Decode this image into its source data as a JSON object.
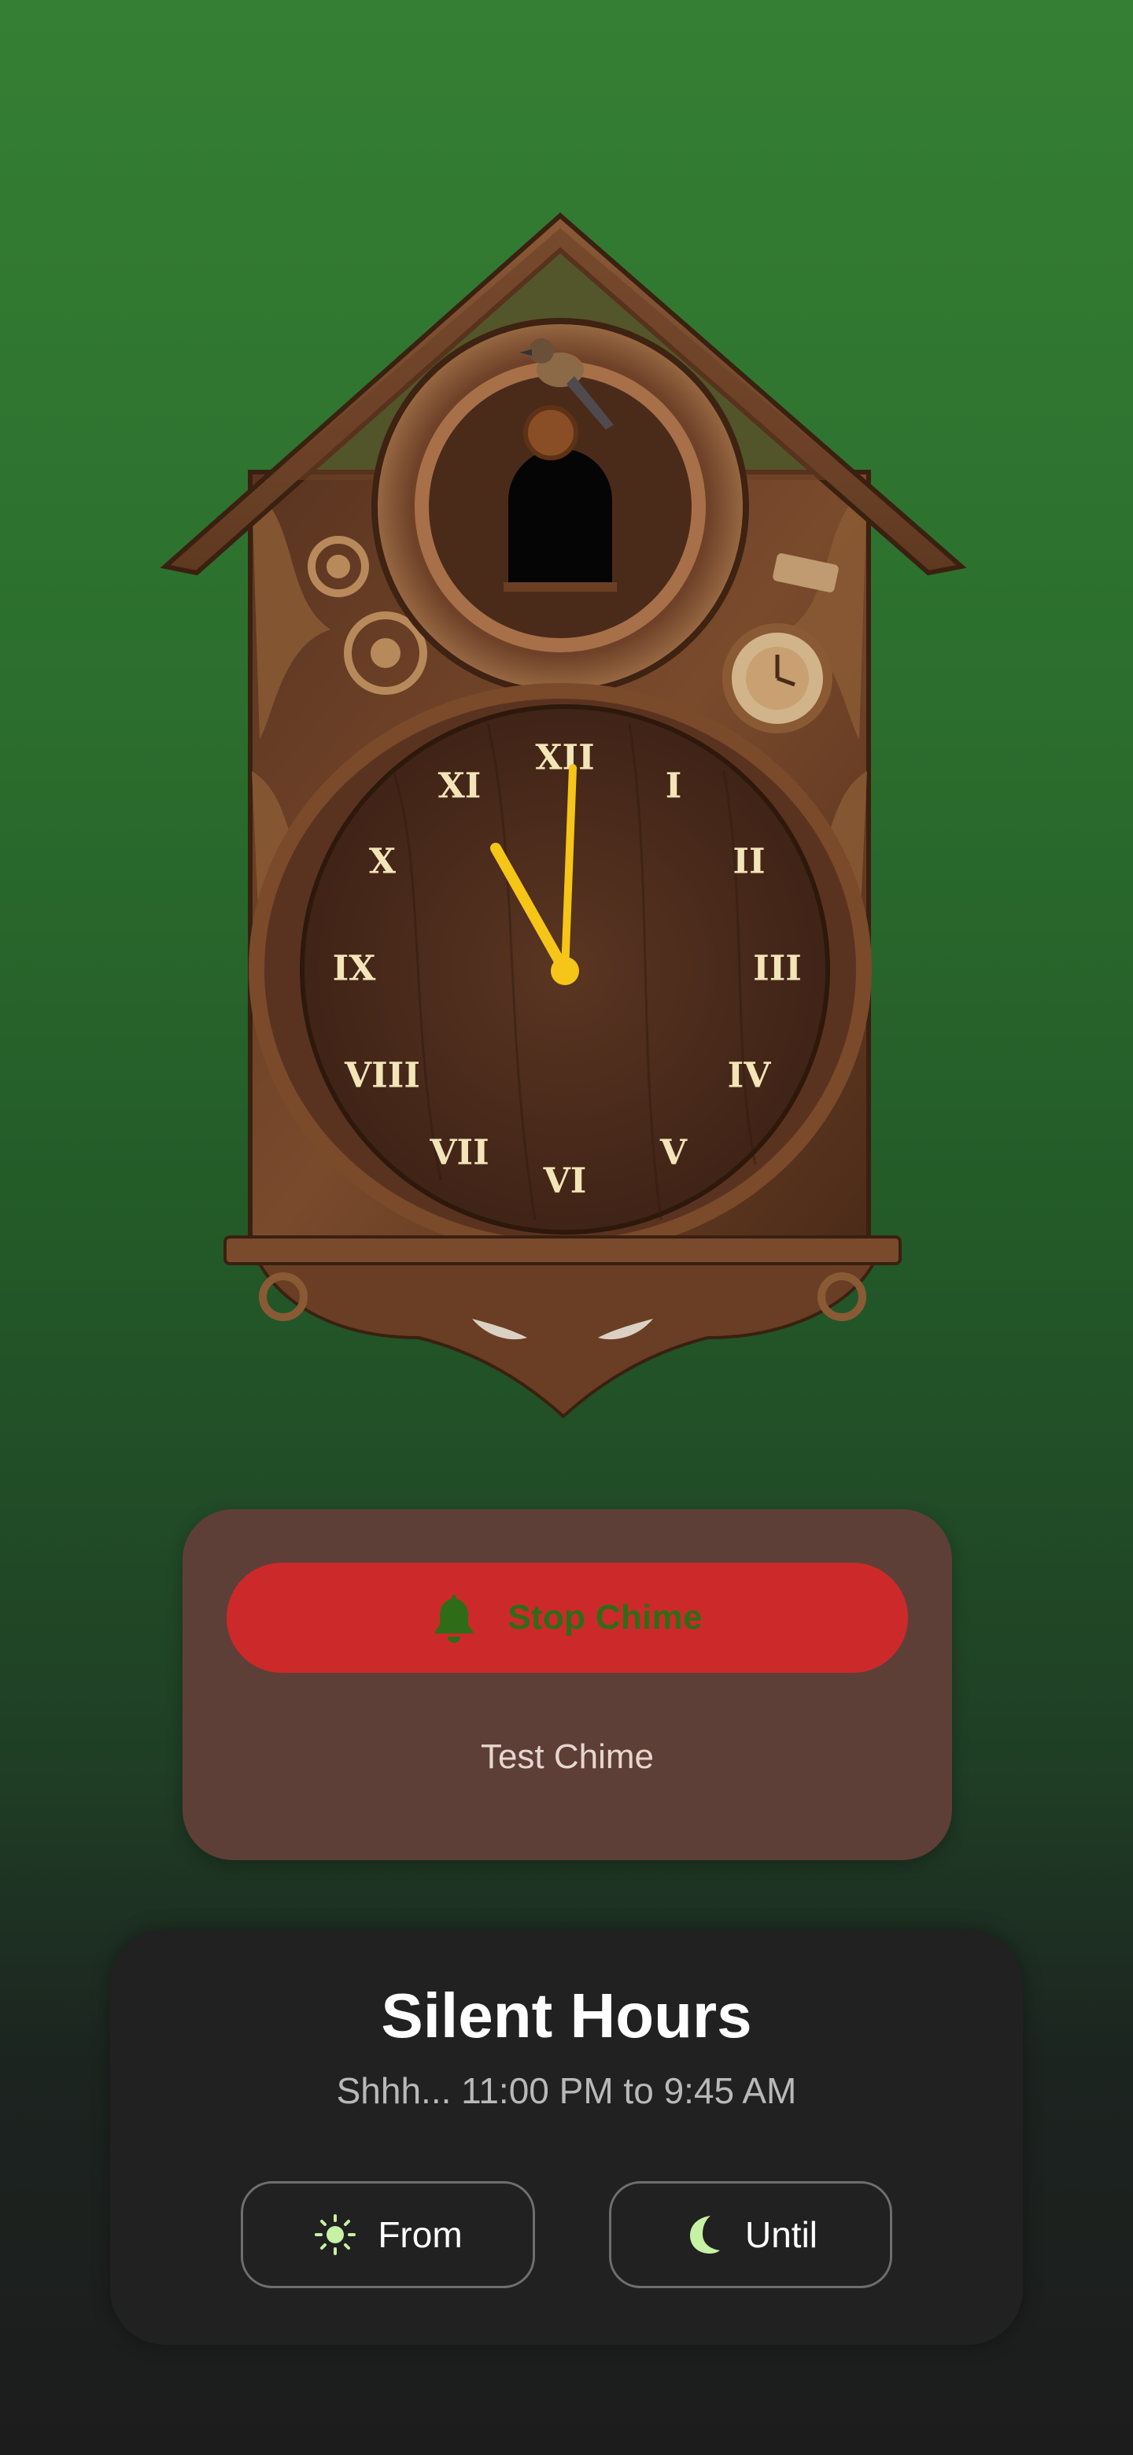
{
  "clock": {
    "numerals": [
      "XII",
      "I",
      "II",
      "III",
      "IV",
      "V",
      "VI",
      "VII",
      "VIII",
      "IX",
      "X",
      "XI"
    ],
    "time_shown": "11:59",
    "hand_color": "#f5c518"
  },
  "chime": {
    "stop_label": "Stop Chime",
    "stop_icon": "bell-icon",
    "test_label": "Test Chime"
  },
  "silent_hours": {
    "title": "Silent Hours",
    "subtitle": "Shhh... 11:00 PM to 9:45 AM",
    "from_label": "From",
    "from_icon": "sun-icon",
    "until_label": "Until",
    "until_icon": "moon-icon"
  },
  "colors": {
    "accent_red": "#cc2a2a",
    "card_brown": "#5e3f37",
    "icon_green": "#c5f2a4"
  }
}
